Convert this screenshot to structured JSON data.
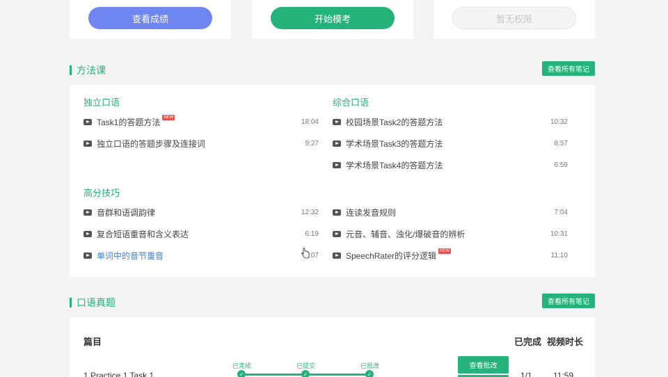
{
  "top_buttons": {
    "view_scores": "查看成绩",
    "start_mock": "开始模考",
    "no_permission": "暂无权限"
  },
  "method_section": {
    "title": "方法课",
    "notes_button": "查看所有笔记",
    "groups": {
      "independent": {
        "title": "独立口语",
        "lessons": [
          {
            "title": "Task1的答题方法",
            "duration": "18:04",
            "new": "NEW"
          },
          {
            "title": "独立口语的答题步骤及连接词",
            "duration": "9:27"
          }
        ]
      },
      "integrated": {
        "title": "综合口语",
        "lessons": [
          {
            "title": "校园场景Task2的答题方法",
            "duration": "10:32"
          },
          {
            "title": "学术场景Task3的答题方法",
            "duration": "8:57"
          },
          {
            "title": "学术场景Task4的答题方法",
            "duration": "6:59"
          }
        ]
      },
      "advanced": {
        "title": "高分技巧",
        "left": [
          {
            "title": "音群和语调韵律",
            "duration": "12:32"
          },
          {
            "title": "复合短语重音和含义表达",
            "duration": "6:19"
          },
          {
            "title": "单词中的音节重音",
            "duration": ":07"
          }
        ],
        "right": [
          {
            "title": "连读发音规则",
            "duration": "7:04"
          },
          {
            "title": "元音、辅音、浊化/爆破音的辨析",
            "duration": "10:31"
          },
          {
            "title": "SpeechRater的评分逻辑",
            "duration": "11:10",
            "new": "NEW"
          }
        ]
      }
    }
  },
  "exam_section": {
    "title": "口语真题",
    "notes_button": "查看所有笔记",
    "headers": {
      "item": "篇目",
      "completed": "已完成",
      "video_length": "视频时长"
    },
    "steps": [
      "已完成",
      "已提交",
      "已批改"
    ],
    "rows": [
      {
        "title": "1 Practice 1 Task 1",
        "review_button": "查看批改",
        "completed": "1/1",
        "video_length": "11:59"
      }
    ]
  },
  "colors": {
    "accent": "#26b27b",
    "blue_button": "#6f85f0",
    "active_link": "#4a7fd6",
    "badge": "#e9504c"
  },
  "icons": {
    "play": "play-icon",
    "check": "check-icon",
    "cursor": "hand-cursor-icon"
  }
}
